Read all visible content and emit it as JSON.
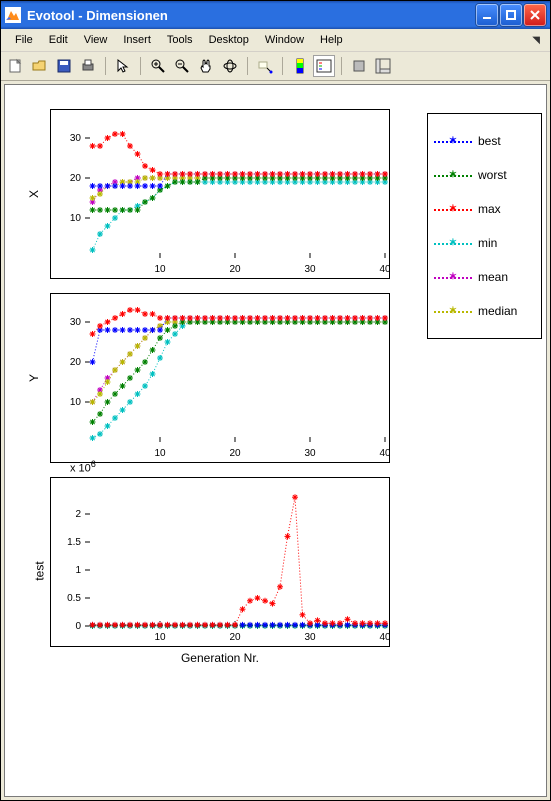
{
  "window": {
    "title": "Evotool - Dimensionen"
  },
  "menu": {
    "items": [
      "File",
      "Edit",
      "View",
      "Insert",
      "Tools",
      "Desktop",
      "Window",
      "Help"
    ]
  },
  "xlabel": "Generation Nr.",
  "legend": [
    "best",
    "worst",
    "max",
    "min",
    "mean",
    "median"
  ],
  "colors": {
    "best": "#0000ff",
    "worst": "#008000",
    "max": "#ff0000",
    "min": "#00c0c0",
    "mean": "#c000c0",
    "median": "#b8b800"
  },
  "exponent_label": "x 10",
  "exponent_power": "6",
  "chart_data": [
    {
      "type": "scatter",
      "ylabel": "X",
      "xlim": [
        0,
        40
      ],
      "ylim": [
        0,
        35
      ],
      "xticks": [
        10,
        20,
        30,
        40
      ],
      "yticks": [
        10,
        20,
        30
      ],
      "x": [
        1,
        2,
        3,
        4,
        5,
        6,
        7,
        8,
        9,
        10,
        11,
        12,
        13,
        14,
        15,
        16,
        17,
        18,
        19,
        20,
        21,
        22,
        23,
        24,
        25,
        26,
        27,
        28,
        29,
        30,
        31,
        32,
        33,
        34,
        35,
        36,
        37,
        38,
        39,
        40
      ],
      "best": [
        18,
        18,
        18,
        18,
        18,
        18,
        18,
        18,
        18,
        18,
        21,
        21,
        21,
        21,
        21,
        21,
        21,
        21,
        21,
        21,
        21,
        21,
        21,
        21,
        21,
        21,
        21,
        21,
        21,
        21,
        21,
        21,
        21,
        21,
        21,
        21,
        21,
        21,
        21,
        21
      ],
      "worst": [
        12,
        12,
        12,
        12,
        12,
        12,
        12,
        14,
        15,
        17,
        18,
        19,
        19,
        19,
        19,
        20,
        20,
        20,
        20,
        20,
        20,
        20,
        20,
        20,
        20,
        20,
        20,
        20,
        20,
        20,
        20,
        20,
        20,
        20,
        20,
        20,
        20,
        20,
        20,
        20
      ],
      "max": [
        28,
        28,
        30,
        31,
        31,
        28,
        26,
        23,
        22,
        21,
        21,
        21,
        21,
        21,
        21,
        21,
        21,
        21,
        21,
        21,
        21,
        21,
        21,
        21,
        21,
        21,
        21,
        21,
        21,
        21,
        21,
        21,
        21,
        21,
        21,
        21,
        21,
        21,
        21,
        21
      ],
      "min": [
        2,
        6,
        8,
        10,
        12,
        12,
        13,
        14,
        15,
        17,
        18,
        19,
        19,
        19,
        19,
        19,
        19,
        19,
        19,
        19,
        19,
        19,
        19,
        19,
        19,
        19,
        19,
        19,
        19,
        19,
        19,
        19,
        19,
        19,
        19,
        19,
        19,
        19,
        19,
        19
      ],
      "mean": [
        14,
        17,
        18,
        19,
        19,
        19,
        20,
        20,
        20,
        20,
        20,
        20,
        20,
        20,
        20,
        20,
        20,
        20,
        20,
        20,
        20,
        20,
        20,
        20,
        20,
        20,
        20,
        20,
        20,
        20,
        20,
        20,
        20,
        20,
        20,
        20,
        20,
        20,
        20,
        20
      ],
      "median": [
        15,
        16,
        18,
        18,
        19,
        19,
        19,
        20,
        20,
        20,
        20,
        20,
        20,
        20,
        20,
        20,
        20,
        20,
        20,
        20,
        20,
        20,
        20,
        20,
        20,
        20,
        20,
        20,
        20,
        20,
        20,
        20,
        20,
        20,
        20,
        20,
        20,
        20,
        20,
        20
      ]
    },
    {
      "type": "scatter",
      "ylabel": "Y",
      "xlim": [
        0,
        40
      ],
      "ylim": [
        0,
        35
      ],
      "xticks": [
        10,
        20,
        30,
        40
      ],
      "yticks": [
        10,
        20,
        30
      ],
      "x": [
        1,
        2,
        3,
        4,
        5,
        6,
        7,
        8,
        9,
        10,
        11,
        12,
        13,
        14,
        15,
        16,
        17,
        18,
        19,
        20,
        21,
        22,
        23,
        24,
        25,
        26,
        27,
        28,
        29,
        30,
        31,
        32,
        33,
        34,
        35,
        36,
        37,
        38,
        39,
        40
      ],
      "best": [
        20,
        28,
        28,
        28,
        28,
        28,
        28,
        28,
        28,
        28,
        31,
        31,
        31,
        31,
        31,
        31,
        31,
        31,
        31,
        31,
        31,
        31,
        31,
        31,
        31,
        31,
        31,
        31,
        31,
        31,
        31,
        31,
        31,
        31,
        31,
        31,
        31,
        31,
        31,
        31
      ],
      "worst": [
        5,
        7,
        10,
        12,
        14,
        16,
        18,
        20,
        23,
        26,
        28,
        29,
        30,
        30,
        30,
        30,
        30,
        30,
        30,
        30,
        30,
        30,
        30,
        30,
        30,
        30,
        30,
        30,
        30,
        30,
        30,
        30,
        30,
        30,
        30,
        30,
        30,
        30,
        30,
        30
      ],
      "max": [
        27,
        29,
        30,
        31,
        32,
        33,
        33,
        32,
        32,
        31,
        31,
        31,
        31,
        31,
        31,
        31,
        31,
        31,
        31,
        31,
        31,
        31,
        31,
        31,
        31,
        31,
        31,
        31,
        31,
        31,
        31,
        31,
        31,
        31,
        31,
        31,
        31,
        31,
        31,
        31
      ],
      "min": [
        1,
        2,
        4,
        6,
        8,
        10,
        12,
        14,
        17,
        21,
        25,
        27,
        29,
        30,
        30,
        30,
        30,
        30,
        30,
        30,
        30,
        30,
        30,
        30,
        30,
        30,
        30,
        30,
        30,
        30,
        30,
        30,
        30,
        30,
        30,
        30,
        30,
        30,
        30,
        30
      ],
      "mean": [
        10,
        13,
        16,
        18,
        20,
        22,
        24,
        26,
        28,
        29,
        30,
        30,
        30,
        30,
        30,
        30,
        30,
        30,
        30,
        30,
        30,
        30,
        30,
        30,
        30,
        30,
        30,
        30,
        30,
        30,
        30,
        30,
        30,
        30,
        30,
        30,
        30,
        30,
        30,
        30
      ],
      "median": [
        10,
        12,
        15,
        18,
        20,
        22,
        24,
        26,
        28,
        29,
        30,
        30,
        30,
        30,
        30,
        30,
        30,
        30,
        30,
        30,
        30,
        30,
        30,
        30,
        30,
        30,
        30,
        30,
        30,
        30,
        30,
        30,
        30,
        30,
        30,
        30,
        30,
        30,
        30,
        30
      ]
    },
    {
      "type": "scatter",
      "ylabel": "test",
      "xlim": [
        0,
        40
      ],
      "ylim": [
        0,
        2.5
      ],
      "exponent": 6,
      "xticks": [
        10,
        20,
        30,
        40
      ],
      "yticks": [
        0,
        0.5,
        1,
        1.5,
        2
      ],
      "x": [
        1,
        2,
        3,
        4,
        5,
        6,
        7,
        8,
        9,
        10,
        11,
        12,
        13,
        14,
        15,
        16,
        17,
        18,
        19,
        20,
        21,
        22,
        23,
        24,
        25,
        26,
        27,
        28,
        29,
        30,
        31,
        32,
        33,
        34,
        35,
        36,
        37,
        38,
        39,
        40
      ],
      "best": [
        0.02,
        0.02,
        0.02,
        0.02,
        0.02,
        0.02,
        0.02,
        0.02,
        0.02,
        0.02,
        0.02,
        0.02,
        0.02,
        0.02,
        0.02,
        0.02,
        0.02,
        0.02,
        0.02,
        0.02,
        0.02,
        0.02,
        0.02,
        0.02,
        0.02,
        0.02,
        0.02,
        0.02,
        0.02,
        0.02,
        0.02,
        0.02,
        0.02,
        0.02,
        0.02,
        0.02,
        0.02,
        0.02,
        0.02,
        0.02
      ],
      "worst": [
        0.01,
        0.01,
        0.01,
        0.01,
        0.01,
        0.01,
        0.01,
        0.01,
        0.01,
        0.01,
        0.01,
        0.01,
        0.01,
        0.01,
        0.01,
        0.01,
        0.01,
        0.01,
        0.01,
        0.01,
        0.01,
        0.01,
        0.01,
        0.01,
        0.01,
        0.01,
        0.01,
        0.01,
        0.01,
        0.01,
        0.01,
        0.01,
        0.01,
        0.01,
        0.01,
        0.01,
        0.01,
        0.01,
        0.01,
        0.01
      ],
      "max": [
        0.02,
        0.02,
        0.02,
        0.02,
        0.02,
        0.02,
        0.02,
        0.02,
        0.02,
        0.02,
        0.02,
        0.02,
        0.02,
        0.02,
        0.02,
        0.02,
        0.02,
        0.02,
        0.02,
        0.02,
        0.3,
        0.45,
        0.5,
        0.45,
        0.4,
        0.7,
        1.6,
        2.3,
        0.2,
        0.05,
        0.1,
        0.05,
        0.05,
        0.05,
        0.12,
        0.05,
        0.05,
        0.05,
        0.05,
        0.05
      ],
      "min": [
        0.0,
        0.0,
        0.0,
        0.0,
        0.0,
        0.0,
        0.0,
        0.0,
        0.0,
        0.0,
        0.0,
        0.0,
        0.0,
        0.0,
        0.0,
        0.0,
        0.0,
        0.0,
        0.0,
        0.0,
        0.0,
        0.0,
        0.0,
        0.0,
        0.0,
        0.0,
        0.0,
        0.0,
        0.0,
        0.0,
        0.0,
        0.0,
        0.0,
        0.0,
        0.0,
        0.0,
        0.0,
        0.0,
        0.0,
        0.0
      ],
      "mean": [
        0.015,
        0.015,
        0.015,
        0.015,
        0.015,
        0.015,
        0.015,
        0.015,
        0.015,
        0.015,
        0.015,
        0.015,
        0.015,
        0.015,
        0.015,
        0.015,
        0.015,
        0.015,
        0.015,
        0.015,
        0.015,
        0.015,
        0.015,
        0.015,
        0.015,
        0.015,
        0.015,
        0.015,
        0.015,
        0.015,
        0.015,
        0.015,
        0.015,
        0.015,
        0.015,
        0.015,
        0.015,
        0.015,
        0.015,
        0.015
      ],
      "median": [
        0.015,
        0.015,
        0.015,
        0.015,
        0.015,
        0.015,
        0.015,
        0.015,
        0.015,
        0.015,
        0.015,
        0.015,
        0.015,
        0.015,
        0.015,
        0.015,
        0.015,
        0.015,
        0.015,
        0.015,
        0.015,
        0.015,
        0.015,
        0.015,
        0.015,
        0.015,
        0.015,
        0.015,
        0.015,
        0.015,
        0.015,
        0.015,
        0.015,
        0.015,
        0.015,
        0.015,
        0.015,
        0.015,
        0.015,
        0.015
      ]
    }
  ]
}
